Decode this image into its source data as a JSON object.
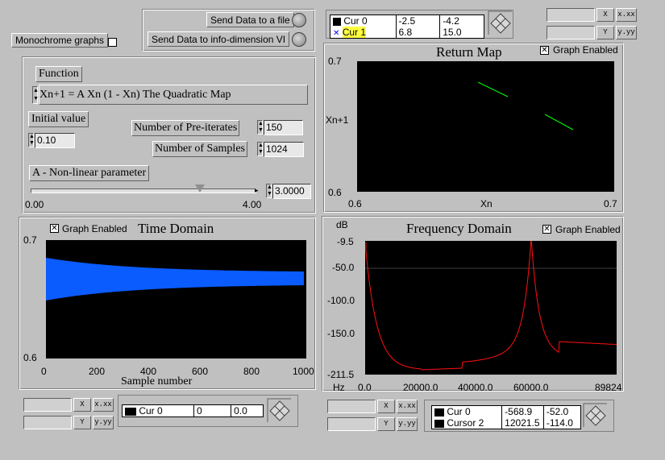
{
  "colors": {
    "plot_bg": "#000000",
    "time_trace": "#0a5cff",
    "freq_trace": "#ff1010",
    "return_trace": "#00ff00",
    "highlight": "#ffff40"
  },
  "top": {
    "monochrome_label": "Monochrome graphs",
    "send_file_label": "Send Data to a file",
    "send_info_label": "Send Data to info-dimension VI"
  },
  "controls": {
    "function_label": "Function",
    "function_value": "Xn+1  = A Xn (1 - Xn)    The Quadratic Map",
    "initial_label": "Initial value",
    "initial_value": "0.10",
    "preiterates_label": "Number of Pre-iterates",
    "preiterates_value": "150",
    "samples_label": "Number of Samples",
    "samples_value": "1024",
    "param_label": "A - Non-linear parameter",
    "param_min": "0.00",
    "param_max": "4.00",
    "param_value": "3.0000",
    "param_level": 3.0
  },
  "return_map": {
    "title": "Return Map",
    "graph_enabled": "Graph Enabled",
    "ymax": "0.7",
    "ymin": "0.6",
    "xmin": "0.6",
    "xmax": "0.7",
    "ylabel": "Xn+1",
    "xlabel": "Xn",
    "cursor_legend": [
      {
        "name": "Cur 0",
        "x": "-2.5",
        "y": "-4.2"
      },
      {
        "name": "Cur 1",
        "x": "6.8",
        "y": "15.0"
      }
    ]
  },
  "time_domain": {
    "title": "Time Domain",
    "graph_enabled": "Graph Enabled",
    "ymax": "0.7",
    "ymin": "0.6",
    "xticks": [
      "0",
      "200",
      "400",
      "600",
      "800",
      "1000"
    ],
    "xlabel": "Sample number",
    "cursor_legend": [
      {
        "name": "Cur 0",
        "x": "0",
        "y": "0.0"
      }
    ]
  },
  "freq_domain": {
    "title": "Frequency Domain",
    "graph_enabled": "Graph Enabled",
    "yunit": "dB",
    "yticks": [
      "-9.5",
      "-50.0",
      "-100.0",
      "-150.0",
      "-211.5"
    ],
    "xticks": [
      "0.0",
      "20000.0",
      "40000.0",
      "60000.0",
      "89824"
    ],
    "xunit": "Hz",
    "cursor_legend": [
      {
        "name": "Cur 0",
        "x": "-568.9",
        "y": "-52.0"
      },
      {
        "name": "Cursor 2",
        "x": "12021.5",
        "y": "-114.0"
      }
    ]
  },
  "scale_buttons": {
    "x_label": "X",
    "y_label": "Y",
    "x_fmt": "x.xx",
    "y_fmt": "y.yy"
  }
}
